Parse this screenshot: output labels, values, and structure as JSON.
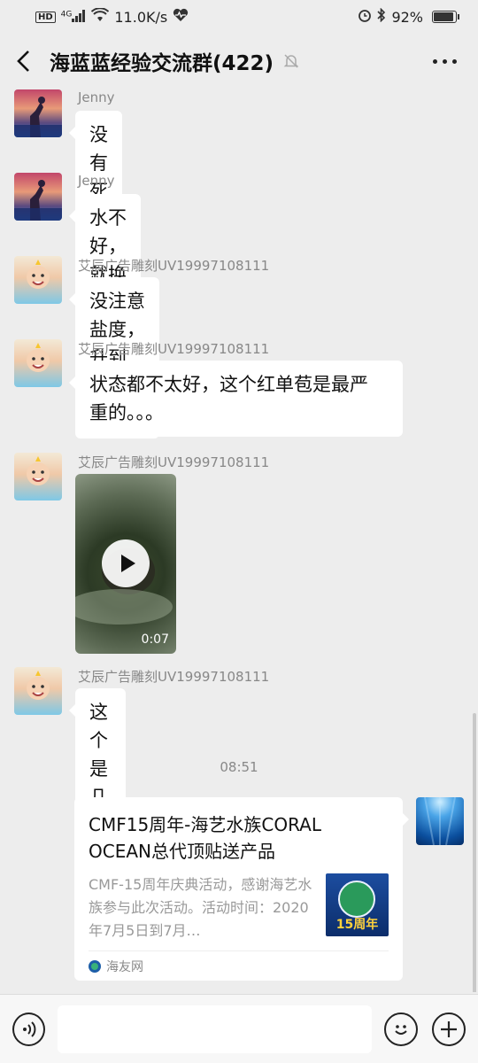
{
  "status_bar": {
    "hd": "HD",
    "network": "4G",
    "speed": "11.0K/s",
    "battery_percent": "92%",
    "battery_level": 0.92
  },
  "header": {
    "title": "海蓝蓝经验交流群(422)"
  },
  "messages": [
    {
      "sender": "Jenny",
      "text": "没有死就有救"
    },
    {
      "sender": "Jenny",
      "text": "水不好，就换个缸试试"
    },
    {
      "sender": "艾辰广告雕刻UV19997108111",
      "text": "没注意盐度，升到 1.030 了。。。"
    },
    {
      "sender": "艾辰广告雕刻UV19997108111",
      "text_line1": "状态都不太好，这个红单苞是最严",
      "text_line2": "重的。。。"
    },
    {
      "sender": "艾辰广告雕刻UV19997108111",
      "video_duration": "0:07"
    },
    {
      "sender": "艾辰广告雕刻UV19997108111",
      "text": "这个是几天前的",
      "emoji": "😭"
    }
  ],
  "timestamp": "08:51",
  "link_card": {
    "title": "CMF15周年-海艺水族CORAL OCEAN总代顶贴送产品",
    "description": "CMF-15周年庆典活动，感谢海艺水族参与此次活动。活动时间：2020年7月5日到7月…",
    "thumb_text": "15周年",
    "source": "海友网"
  }
}
